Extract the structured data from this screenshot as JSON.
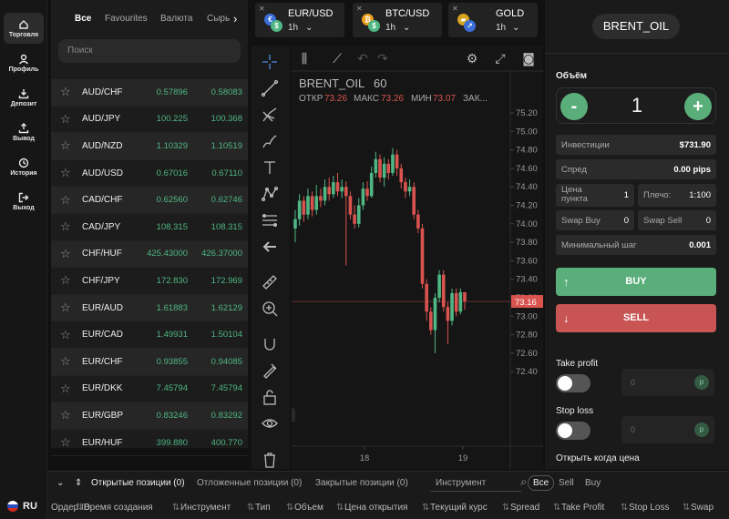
{
  "nav": {
    "items": [
      {
        "label": "Торговля",
        "icon": "home-icon"
      },
      {
        "label": "Профиль",
        "icon": "user-icon"
      },
      {
        "label": "Депозит",
        "icon": "deposit-icon"
      },
      {
        "label": "Вывод",
        "icon": "withdraw-icon"
      },
      {
        "label": "История",
        "icon": "history-icon"
      },
      {
        "label": "Выход",
        "icon": "logout-icon"
      }
    ],
    "lang": "RU"
  },
  "instruments": {
    "tabs": [
      "Все",
      "Favourites",
      "Валюта",
      "Сырь"
    ],
    "search_placeholder": "Поиск",
    "rows": [
      {
        "sym": "AUD/CHF",
        "bid": "0.57896",
        "ask": "0.58083"
      },
      {
        "sym": "AUD/JPY",
        "bid": "100.225",
        "ask": "100.368"
      },
      {
        "sym": "AUD/NZD",
        "bid": "1.10329",
        "ask": "1.10519"
      },
      {
        "sym": "AUD/USD",
        "bid": "0.67016",
        "ask": "0.67110"
      },
      {
        "sym": "CAD/CHF",
        "bid": "0.62560",
        "ask": "0.62746"
      },
      {
        "sym": "CAD/JPY",
        "bid": "108.315",
        "ask": "108.315"
      },
      {
        "sym": "CHF/HUF",
        "bid": "425.43000",
        "ask": "426.37000"
      },
      {
        "sym": "CHF/JPY",
        "bid": "172.830",
        "ask": "172.969"
      },
      {
        "sym": "EUR/AUD",
        "bid": "1.61883",
        "ask": "1.62129"
      },
      {
        "sym": "EUR/CAD",
        "bid": "1.49931",
        "ask": "1.50104"
      },
      {
        "sym": "EUR/CHF",
        "bid": "0.93855",
        "ask": "0.94085"
      },
      {
        "sym": "EUR/DKK",
        "bid": "7.45794",
        "ask": "7.45794"
      },
      {
        "sym": "EUR/GBP",
        "bid": "0.83246",
        "ask": "0.83292"
      },
      {
        "sym": "EUR/HUF",
        "bid": "399.880",
        "ask": "400.770"
      }
    ]
  },
  "top_tabs": [
    {
      "name": "EUR/USD",
      "tf": "1h"
    },
    {
      "name": "BTC/USD",
      "tf": "1h"
    },
    {
      "name": "GOLD",
      "tf": "1h"
    }
  ],
  "chart": {
    "symbol": "BRENT_OIL",
    "interval": "60",
    "ohlc_label_open": "ОТКР",
    "open": "73.26",
    "ohlc_label_high": "МАКС",
    "high": "73.26",
    "ohlc_label_low": "МИН",
    "low": "73.07",
    "ohlc_label_close": "ЗАК...",
    "last_price": "73.16",
    "colors": {
      "up": "#4fb783",
      "down": "#d9534f"
    }
  },
  "chart_data": {
    "type": "candlestick",
    "xticks": [
      "18",
      "19"
    ],
    "yticks": [
      "72.40",
      "72.60",
      "72.80",
      "73.00",
      "73.20",
      "73.40",
      "73.60",
      "73.80",
      "74.00",
      "74.20",
      "74.40",
      "74.60",
      "74.80",
      "75.00",
      "75.20"
    ],
    "ylim": [
      72.3,
      75.3
    ],
    "last": 73.16,
    "candles": [
      [
        73.95,
        74.05,
        74.15,
        73.8
      ],
      [
        74.05,
        74.25,
        74.32,
        73.98
      ],
      [
        74.25,
        74.1,
        74.3,
        74.02
      ],
      [
        74.1,
        74.3,
        74.38,
        74.05
      ],
      [
        74.3,
        74.15,
        74.35,
        74.08
      ],
      [
        74.15,
        74.3,
        74.42,
        74.1
      ],
      [
        74.3,
        74.25,
        74.38,
        74.18
      ],
      [
        74.25,
        74.4,
        74.48,
        74.2
      ],
      [
        74.4,
        74.32,
        74.5,
        74.25
      ],
      [
        74.32,
        74.45,
        74.52,
        74.28
      ],
      [
        74.45,
        74.35,
        74.55,
        74.3
      ],
      [
        74.35,
        74.4,
        74.48,
        74.28
      ],
      [
        74.4,
        74.3,
        74.46,
        73.55
      ],
      [
        74.3,
        74.1,
        74.35,
        74.05
      ],
      [
        74.1,
        74.0,
        74.2,
        73.95
      ],
      [
        74.0,
        74.2,
        74.28,
        73.96
      ],
      [
        74.2,
        74.38,
        74.45,
        74.15
      ],
      [
        74.38,
        74.3,
        74.46,
        74.25
      ],
      [
        74.3,
        74.55,
        74.62,
        74.28
      ],
      [
        74.55,
        74.7,
        74.78,
        74.5
      ],
      [
        74.7,
        74.5,
        74.75,
        74.45
      ],
      [
        74.5,
        74.65,
        74.72,
        74.4
      ],
      [
        74.65,
        74.55,
        74.7,
        74.48
      ],
      [
        74.55,
        74.75,
        74.82,
        74.52
      ],
      [
        74.75,
        74.6,
        74.8,
        74.52
      ],
      [
        74.6,
        74.45,
        74.65,
        74.38
      ],
      [
        74.45,
        74.35,
        74.5,
        74.28
      ],
      [
        74.35,
        74.4,
        74.48,
        74.3
      ],
      [
        74.4,
        74.1,
        74.45,
        74.05
      ],
      [
        74.1,
        73.95,
        74.15,
        73.9
      ],
      [
        73.95,
        73.35,
        74.0,
        73.3
      ],
      [
        73.35,
        73.05,
        73.4,
        72.95
      ],
      [
        73.05,
        72.85,
        73.1,
        72.8
      ],
      [
        72.85,
        73.2,
        73.25,
        72.6
      ],
      [
        73.2,
        73.45,
        73.5,
        73.15
      ],
      [
        73.45,
        73.1,
        73.5,
        73.05
      ],
      [
        73.1,
        72.95,
        73.15,
        72.7
      ],
      [
        72.95,
        73.25,
        73.3,
        72.9
      ],
      [
        73.25,
        73.05,
        73.3,
        73.0
      ],
      [
        73.05,
        73.26,
        73.3,
        73.02
      ],
      [
        73.26,
        73.16,
        73.26,
        73.07
      ]
    ]
  },
  "order": {
    "symbol": "BRENT_OIL",
    "volume_label": "Объём",
    "volume": "1",
    "minus": "-",
    "plus": "+",
    "invest_label": "Инвестиции",
    "invest": "$731.90",
    "spread_label": "Спред",
    "spread": "0.00 pips",
    "pip_label_1": "Цена",
    "pip_label_2": "пункта",
    "pip": "1",
    "lev_label": "Плечо:",
    "lev": "1:100",
    "swapbuy_label": "Swap Buy",
    "swapbuy": "0",
    "swapsell_label": "Swap Sell",
    "swapsell": "0",
    "minstep_label": "Минимальный шаг",
    "minstep": "0.001",
    "buy": "BUY",
    "sell": "SELL",
    "tp_label": "Take profit",
    "sl_label": "Stop loss",
    "tp_value": "0",
    "sl_value": "0",
    "pin": "p",
    "open_when_label": "Открыть когда цена"
  },
  "bottom": {
    "tabs": [
      "Открытые позиции (0)",
      "Отложенные позиции (0)",
      "Закрытые позиции (0)"
    ],
    "instrument_label": "Инструмент",
    "filters": [
      "Все",
      "Sell",
      "Buy"
    ],
    "columns": [
      "Ордер ID",
      "Время создания",
      "Инструмент",
      "Тип",
      "Объем",
      "Цена открытия",
      "Текущий курс",
      "Spread",
      "Take Profit",
      "Stop Loss",
      "Swap"
    ]
  }
}
